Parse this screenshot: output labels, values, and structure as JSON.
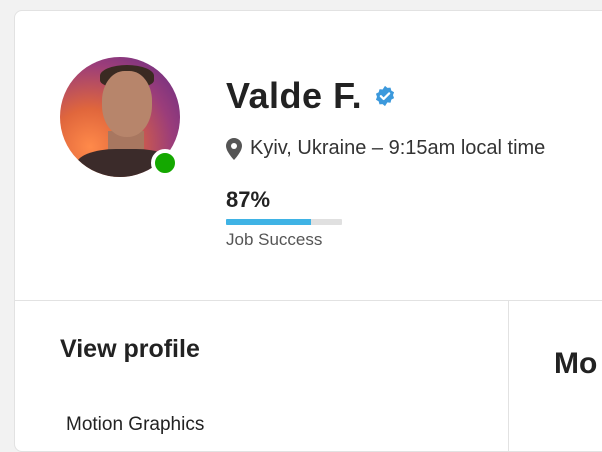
{
  "profile": {
    "name": "Valde F.",
    "location": "Kyiv, Ukraine – 9:15am local time",
    "job_success_value": "87%",
    "job_success_fraction": 0.73,
    "job_success_label": "Job Success",
    "online": true
  },
  "left_panel": {
    "title": "View profile",
    "items": [
      "Motion Graphics"
    ]
  },
  "right_panel": {
    "heading_partial": "Mo"
  },
  "colors": {
    "online": "#14a800",
    "verified": "#3c99dc",
    "progress": "#3fb3e5"
  },
  "icons": {
    "verified": "verified-badge-icon",
    "location": "location-pin-icon"
  }
}
